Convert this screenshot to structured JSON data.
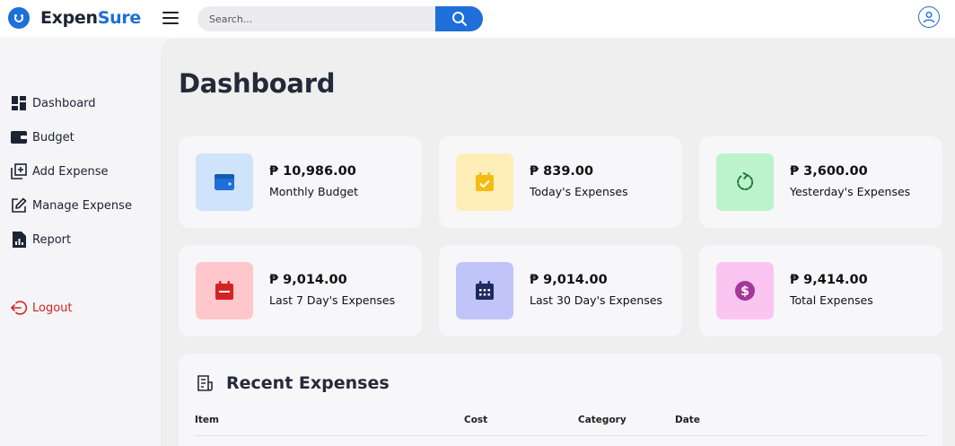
{
  "app": {
    "name_primary": "Expen",
    "name_accent": "Sure"
  },
  "colors": {
    "brand": "#1e6fd9",
    "logout": "#d32424"
  },
  "search": {
    "placeholder": "Search...",
    "value": ""
  },
  "sidebar": {
    "items": [
      {
        "label": "Dashboard",
        "icon": "dashboard-grid-icon"
      },
      {
        "label": "Budget",
        "icon": "wallet-icon"
      },
      {
        "label": "Add Expense",
        "icon": "add-square-icon"
      },
      {
        "label": "Manage Expense",
        "icon": "edit-icon"
      },
      {
        "label": "Report",
        "icon": "report-chart-icon"
      }
    ],
    "logout_label": "Logout"
  },
  "page": {
    "title": "Dashboard"
  },
  "cards": [
    {
      "amount": "₱ 10,986.00",
      "label": "Monthly Budget",
      "icon": "wallet-icon"
    },
    {
      "amount": "₱ 839.00",
      "label": "Today's Expenses",
      "icon": "calendar-check-icon"
    },
    {
      "amount": "₱ 3,600.00",
      "label": "Yesterday's Expenses",
      "icon": "undo-arrow-icon"
    },
    {
      "amount": "₱ 9,014.00",
      "label": "Last 7 Day's Expenses",
      "icon": "calendar-icon"
    },
    {
      "amount": "₱ 9,014.00",
      "label": "Last 30 Day's Expenses",
      "icon": "calendar-grid-icon"
    },
    {
      "amount": "₱ 9,414.00",
      "label": "Total Expenses",
      "icon": "dollar-coin-icon"
    }
  ],
  "recent": {
    "title": "Recent Expenses",
    "columns": [
      "Item",
      "Cost",
      "Category",
      "Date"
    ]
  }
}
